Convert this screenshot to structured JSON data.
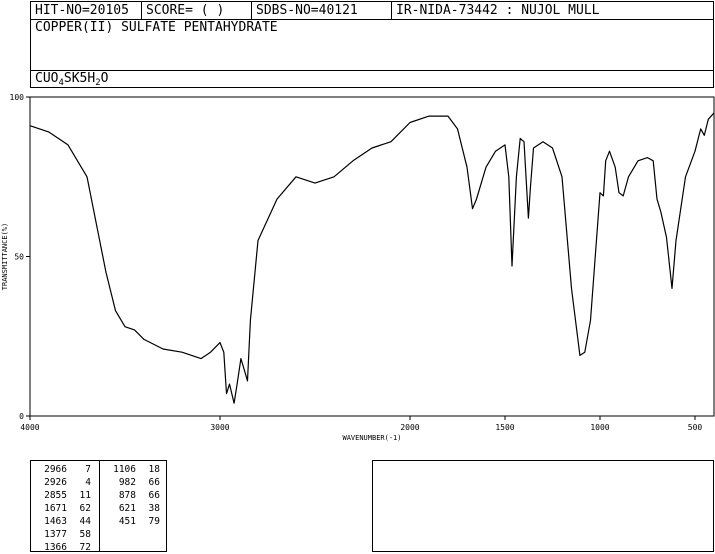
{
  "header": {
    "hit_no": "HIT-NO=20105",
    "score": "SCORE=  (   )",
    "sdbs_no": "SDBS-NO=40121",
    "ir_nida": "IR-NIDA-73442 : NUJOL MULL"
  },
  "compound_name": "COPPER(II) SULFATE PENTAHYDRATE",
  "formula": {
    "part1": "CUO",
    "sub1": "4",
    "part2": "SK5H",
    "sub2": "2",
    "part3": "O"
  },
  "chart_data": {
    "type": "line",
    "xlabel": "WAVENUMBER(-1)",
    "ylabel": "TRANSMITTANCE(%)",
    "xlim": [
      4000,
      400
    ],
    "ylim": [
      0,
      100
    ],
    "x_ticks": [
      4000,
      3000,
      2000,
      1500,
      1000,
      500
    ],
    "y_ticks": [
      0,
      50,
      100
    ],
    "series": [
      {
        "points": [
          [
            4000,
            91
          ],
          [
            3900,
            89
          ],
          [
            3800,
            85
          ],
          [
            3700,
            75
          ],
          [
            3650,
            60
          ],
          [
            3600,
            45
          ],
          [
            3550,
            33
          ],
          [
            3500,
            28
          ],
          [
            3450,
            27
          ],
          [
            3400,
            24
          ],
          [
            3300,
            21
          ],
          [
            3200,
            20
          ],
          [
            3100,
            18
          ],
          [
            3050,
            20
          ],
          [
            3000,
            23
          ],
          [
            2980,
            20
          ],
          [
            2966,
            7
          ],
          [
            2950,
            10
          ],
          [
            2926,
            4
          ],
          [
            2910,
            10
          ],
          [
            2890,
            18
          ],
          [
            2870,
            14
          ],
          [
            2855,
            11
          ],
          [
            2840,
            30
          ],
          [
            2800,
            55
          ],
          [
            2700,
            68
          ],
          [
            2600,
            75
          ],
          [
            2500,
            73
          ],
          [
            2400,
            75
          ],
          [
            2300,
            80
          ],
          [
            2200,
            84
          ],
          [
            2100,
            86
          ],
          [
            2000,
            92
          ],
          [
            1900,
            94
          ],
          [
            1800,
            94
          ],
          [
            1750,
            90
          ],
          [
            1700,
            78
          ],
          [
            1671,
            65
          ],
          [
            1650,
            68
          ],
          [
            1600,
            78
          ],
          [
            1550,
            83
          ],
          [
            1500,
            85
          ],
          [
            1480,
            75
          ],
          [
            1463,
            47
          ],
          [
            1440,
            75
          ],
          [
            1420,
            87
          ],
          [
            1400,
            86
          ],
          [
            1377,
            62
          ],
          [
            1366,
            72
          ],
          [
            1350,
            84
          ],
          [
            1300,
            86
          ],
          [
            1250,
            84
          ],
          [
            1200,
            75
          ],
          [
            1150,
            40
          ],
          [
            1106,
            19
          ],
          [
            1080,
            20
          ],
          [
            1050,
            30
          ],
          [
            1000,
            70
          ],
          [
            982,
            69
          ],
          [
            970,
            80
          ],
          [
            950,
            83
          ],
          [
            920,
            78
          ],
          [
            900,
            70
          ],
          [
            878,
            69
          ],
          [
            850,
            75
          ],
          [
            800,
            80
          ],
          [
            750,
            81
          ],
          [
            720,
            80
          ],
          [
            700,
            68
          ],
          [
            680,
            64
          ],
          [
            650,
            56
          ],
          [
            621,
            40
          ],
          [
            600,
            55
          ],
          [
            550,
            75
          ],
          [
            500,
            83
          ],
          [
            470,
            90
          ],
          [
            451,
            88
          ],
          [
            430,
            93
          ],
          [
            400,
            95
          ]
        ]
      }
    ]
  },
  "peaks": {
    "col1": [
      [
        "2966",
        "7"
      ],
      [
        "2926",
        "4"
      ],
      [
        "2855",
        "11"
      ],
      [
        "1671",
        "62"
      ],
      [
        "1463",
        "44"
      ],
      [
        "1377",
        "58"
      ],
      [
        "1366",
        "72"
      ]
    ],
    "col2": [
      [
        "1106",
        "18"
      ],
      [
        "982",
        "66"
      ],
      [
        "878",
        "66"
      ],
      [
        "621",
        "38"
      ],
      [
        "451",
        "79"
      ]
    ]
  }
}
